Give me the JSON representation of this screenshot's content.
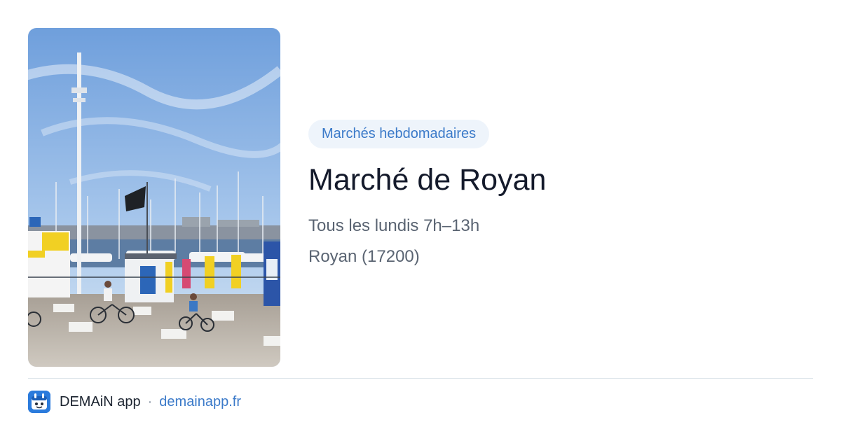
{
  "photo": {
    "alt": "Port de Royan",
    "colors": {
      "sky_top": "#6f9fdc",
      "sky_bottom": "#cfe1f3",
      "ground": "#b9b2a8"
    }
  },
  "info": {
    "tag": "Marchés hebdomadaires",
    "title": "Marché de Royan",
    "schedule": "Tous les lundis 7h–13h",
    "place": "Royan (17200)"
  },
  "footer": {
    "logo_icon": "demain-app-icon",
    "brand": "DEMAiN app",
    "separator": "·",
    "site": "demainapp.fr"
  },
  "colors": {
    "accent": "#3b7ac9",
    "tag_background": "#eef4fb",
    "title": "#141a2b",
    "text_muted": "#5a6472"
  }
}
